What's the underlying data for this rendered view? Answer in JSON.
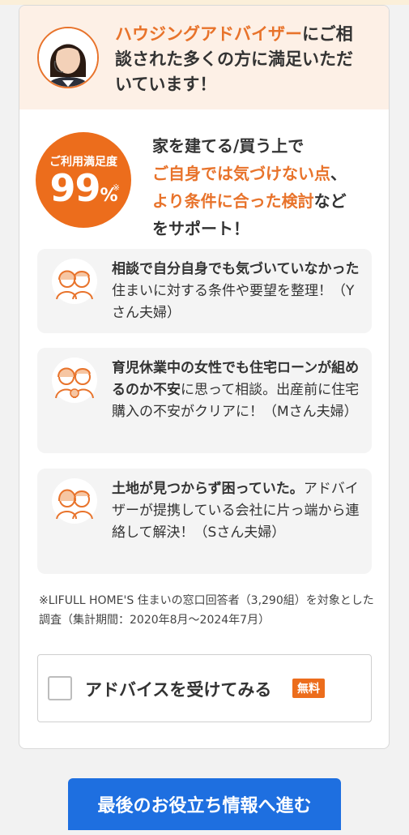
{
  "advisor": {
    "highlight": "ハウジングアドバイザー",
    "text_line1_rest": "にご相",
    "text_line2": "談された多くの方に満足いただ",
    "text_line3": "いています！"
  },
  "badge": {
    "label": "ご利用満足度",
    "value": "99",
    "unit": "%",
    "mark": "※"
  },
  "support": {
    "line1": "家を建てる/買う上で",
    "line2_highlight": "ご自身では気づけない点",
    "line2_rest": "、",
    "line3_highlight": "より条件に合った検討",
    "line3_rest": "など",
    "line4": "をサポート！"
  },
  "testimonials": [
    {
      "bold": "相談で自分自身でも気づいていな",
      "bold2": "かった",
      "rest": "住まいに対する条件や要望を整理！（Yさん夫婦）"
    },
    {
      "bold": "育児休業中の女性でも住宅ローン",
      "bold2": "が組めるのか不安",
      "rest": "に思って相談。出産前に住宅購入の不安がクリアに！（Mさん夫婦）"
    },
    {
      "bold": "土地が見つからず困っていた。",
      "bold2": "",
      "rest": "アドバイザーが提携している会社に片っ端から連絡して解決！（Sさん夫婦）"
    }
  ],
  "footnote": "※LIFULL HOME'S 住まいの窓口回答者（3,290組）を対象とした調査（集計期間：2020年8月〜2024年7月）",
  "cta": {
    "label": "アドバイスを受けてみる",
    "free": "無料"
  },
  "next_button": "最後のお役立ち情報へ進む",
  "colors": {
    "accent": "#ec6d1c",
    "button": "#1e6fe0",
    "header_bg": "#fdf0e6"
  }
}
